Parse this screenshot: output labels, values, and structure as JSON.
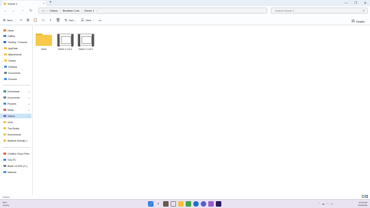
{
  "window": {
    "tab_title": "Scene 1",
    "new_tab": "+",
    "minimize": "—",
    "maximize": "❐",
    "close": "✕",
    "tab_close": "×"
  },
  "addr": {
    "back": "←",
    "forward": "→",
    "up": "↑",
    "refresh": "↻",
    "crumbs": [
      "Videos",
      "Bedtime Cuts",
      "Scene 1"
    ],
    "crumb_sep": "›",
    "search_placeholder": "Search Scene 1"
  },
  "toolbar": {
    "new_label": "New",
    "sort_label": "Sort",
    "view_label": "View",
    "more": "•••",
    "details_label": "Details"
  },
  "sidebar": {
    "quick": [
      {
        "label": "Home",
        "color": "#e0782f"
      },
      {
        "label": "Gallery",
        "color": "#3b82c4"
      }
    ],
    "onedrive": {
      "label": "Timothy - Persona",
      "color": "#1e6fd8"
    },
    "onedrive_children": [
      {
        "label": "AppData",
        "color": "#f2c13b"
      },
      {
        "label": "Attachments",
        "color": "#f2c13b"
      },
      {
        "label": "Classic",
        "color": "#f2c13b"
      },
      {
        "label": "Desktop",
        "color": "#3d8ee0"
      },
      {
        "label": "Documents",
        "color": "#6b7b8c"
      },
      {
        "label": "Pictures",
        "color": "#3d8ee0"
      }
    ],
    "pinned": [
      {
        "label": "Downloads",
        "color": "#2f9e6d"
      },
      {
        "label": "Documents",
        "color": "#6b7b8c"
      },
      {
        "label": "Pictures",
        "color": "#3d8ee0"
      },
      {
        "label": "Music",
        "color": "#e0584a"
      },
      {
        "label": "Videos",
        "color": "#8a5cd8"
      },
      {
        "label": "Vivid",
        "color": "#f2c13b"
      },
      {
        "label": "Tiny Books",
        "color": "#f2c13b"
      },
      {
        "label": "Screenshots",
        "color": "#f2c13b"
      },
      {
        "label": "Bedtime Animals 1",
        "color": "#f2c13b"
      }
    ],
    "devices": [
      {
        "label": "Creative Cloud Files",
        "color": "#e0584a"
      },
      {
        "label": "This PC",
        "color": "#3d8ee0"
      },
      {
        "label": "Blade 15 SSD (C:)",
        "color": "#6b7b8c"
      },
      {
        "label": "Network",
        "color": "#3d8ee0"
      }
    ],
    "pin_glyph": "📌",
    "chev": "›",
    "chev_open": "⌄"
  },
  "items": [
    {
      "label": "Done",
      "type": "folder"
    },
    {
      "label": "Scene 1 Cut 1",
      "type": "video"
    },
    {
      "label": "Scene 1 Cut 2",
      "type": "video"
    }
  ],
  "status": {
    "count": "3 items"
  },
  "taskbar": {
    "temp": "59°F",
    "weather": "Cloudy",
    "time": "10:15 AM",
    "date": "6/20/2024"
  }
}
